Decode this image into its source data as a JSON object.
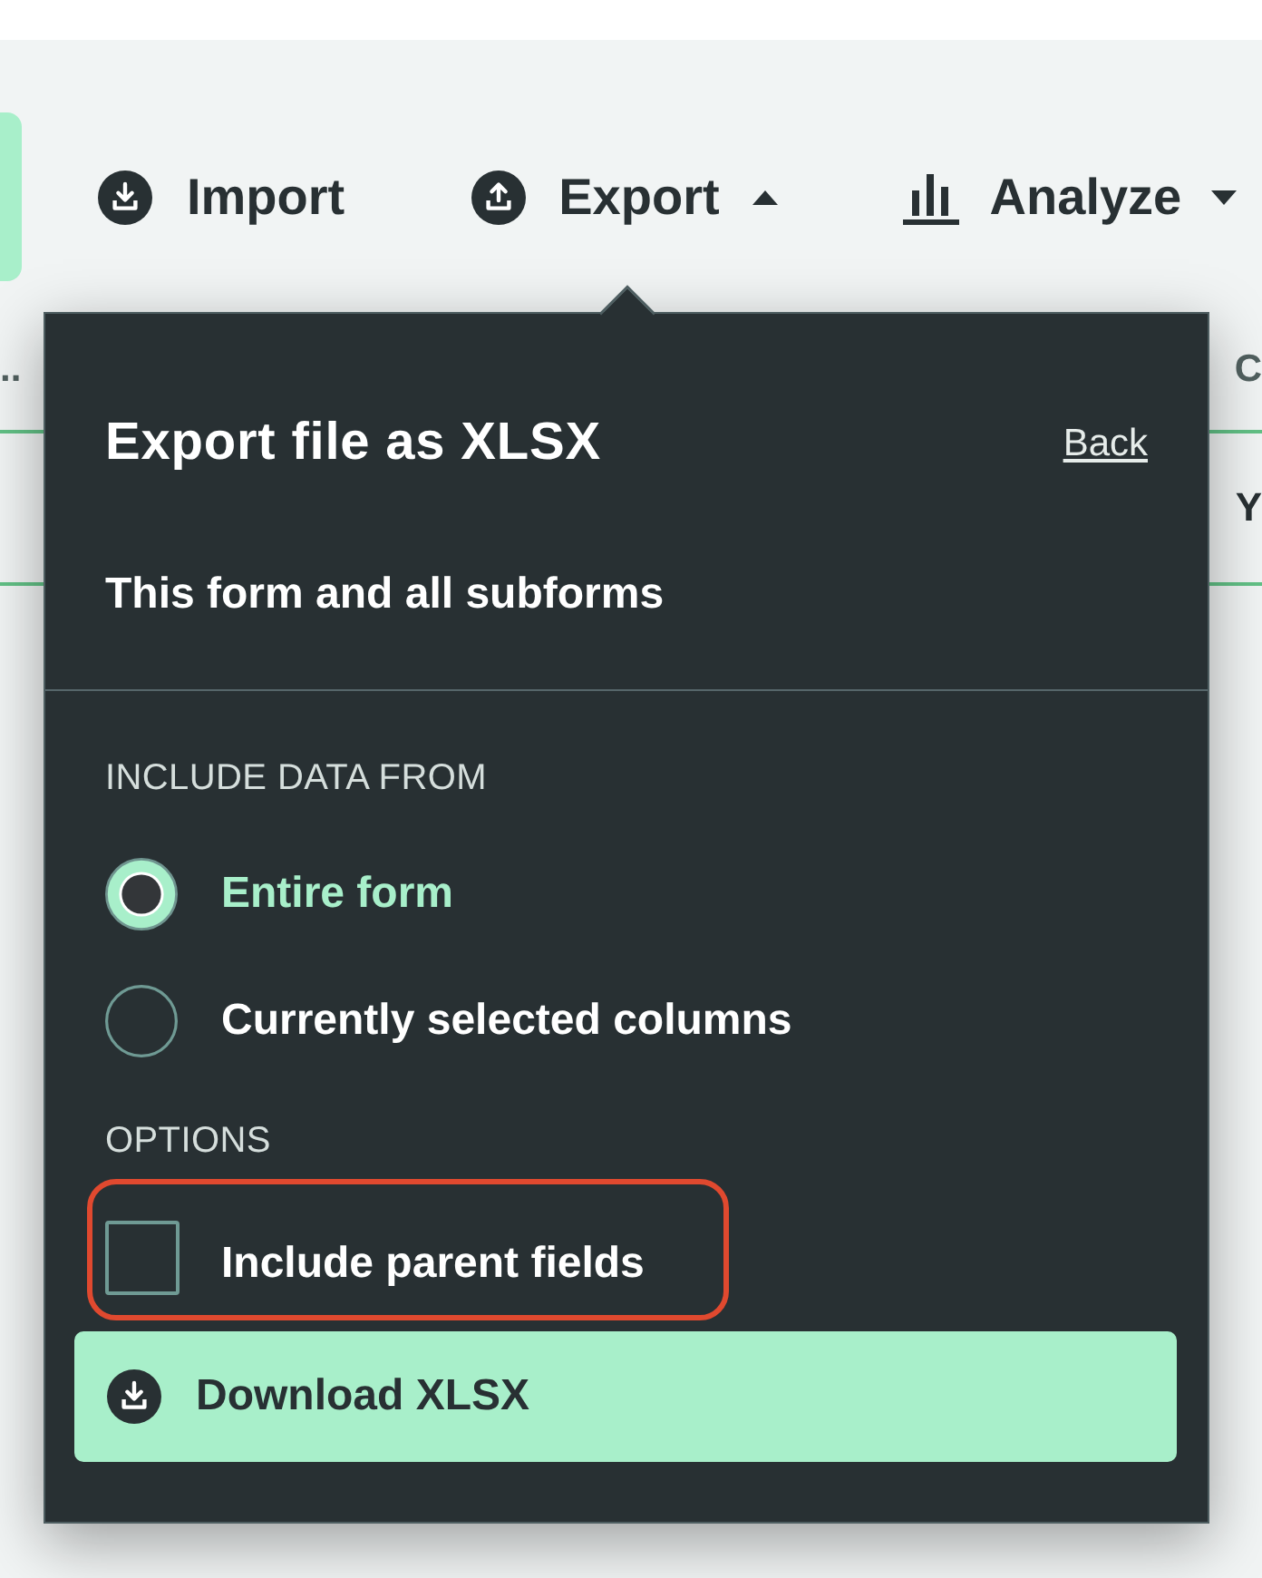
{
  "toolbar": {
    "import_button": "Import",
    "menus": [
      {
        "label": "Export",
        "expanded": true
      },
      {
        "label": "Analyze",
        "expanded": false
      }
    ]
  },
  "background_table": {
    "header_row": [
      "..",
      "C"
    ],
    "rows": [
      {
        "cells": [
          "Y"
        ]
      }
    ]
  },
  "export_panel": {
    "title": "Export file as XLSX",
    "back_link": "Back",
    "scope": "This form and all subforms",
    "include_data_from": {
      "heading": "INCLUDE DATA FROM",
      "options": [
        {
          "label": "Entire form",
          "selected": true
        },
        {
          "label": "Currently selected columns",
          "selected": false
        }
      ]
    },
    "options": {
      "heading": "OPTIONS",
      "checkboxes": [
        {
          "label": "Include parent fields",
          "checked": false,
          "highlighted": true
        }
      ]
    },
    "download_button": "Download XLSX"
  }
}
